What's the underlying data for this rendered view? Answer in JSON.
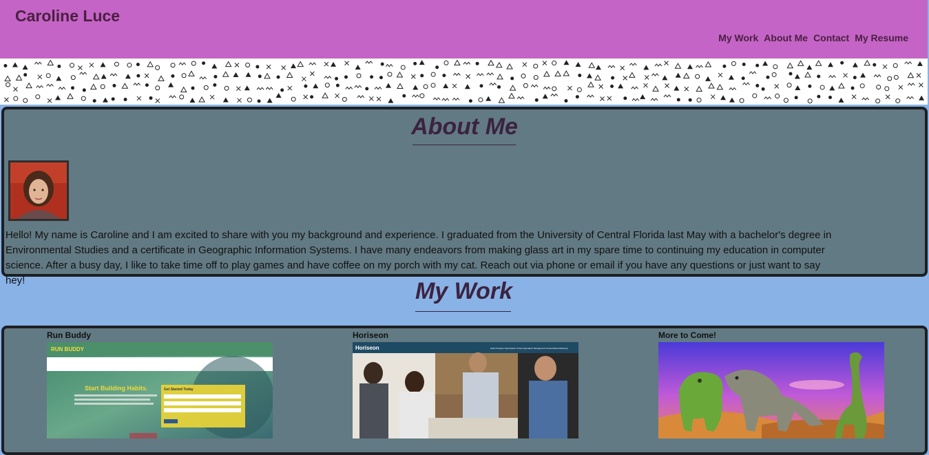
{
  "header": {
    "title": "Caroline Luce",
    "nav": [
      "My Work",
      "About Me",
      "Contact",
      "My Resume"
    ]
  },
  "about": {
    "heading": "About Me",
    "bio": "Hello! My name is Caroline and I am excited to share with you my background and experience. I graduated from the University of Central Florida last May with a bachelor's degree in Environmental Studies and a certificate in Geographic Information Systems. I have many endeavors from making glass art in my spare time to continuing my education in computer science. After a busy day, I like to take time off to play games and have coffee on my porch with my cat. Reach out via phone or email if you have any questions or just want to say hey!"
  },
  "work": {
    "heading": "My Work",
    "projects": [
      {
        "title": "Run Buddy",
        "thumb_text": "RUN BUDDY",
        "tagline": "Start Building Habits.",
        "form_title": "Get Started Today"
      },
      {
        "title": "Horiseon",
        "thumb_text": "Horiseon",
        "nav_text": "Search Engine Optimization   Online Reputation Management   Social Media Marketing"
      },
      {
        "title": "More to Come!"
      }
    ]
  },
  "colors": {
    "header_bg": "#c464c6",
    "page_bg": "#89b2e6",
    "panel_bg": "#627a83",
    "title_color": "#3b2340"
  }
}
